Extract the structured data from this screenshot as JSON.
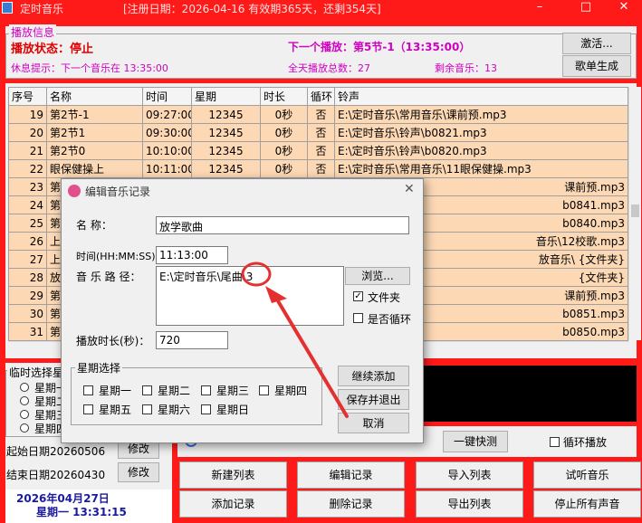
{
  "window": {
    "title": "定时音乐",
    "reg_info": "[注册日期：2026-04-16  有效期365天，还剩354天]"
  },
  "info": {
    "group_label": "播放信息",
    "status": "播放状态：停止",
    "next": "下一个播放：第5节-1（13:35:00）",
    "rest": "休息提示：下一个音乐在 13:35:00",
    "total": "全天播放总数：27",
    "remain": "剩余音乐：13",
    "activate_btn": "激活...",
    "gen_btn": "歌单生成"
  },
  "table": {
    "headers": [
      "序号",
      "名称",
      "时间",
      "星期",
      "时长",
      "循环",
      "铃声"
    ],
    "rows": [
      [
        "19",
        "第2节-1",
        "09:27:00",
        "12345",
        "0秒",
        "否",
        "E:\\定时音乐\\常用音乐\\课前预.mp3"
      ],
      [
        "20",
        "第2节1",
        "09:30:00",
        "12345",
        "0秒",
        "否",
        "E:\\定时音乐\\铃声\\b0821.mp3"
      ],
      [
        "21",
        "第2节0",
        "10:10:00",
        "12345",
        "0秒",
        "否",
        "E:\\定时音乐\\铃声\\b0820.mp3"
      ],
      [
        "22",
        "眼保健操上",
        "10:11:00",
        "12345",
        "0秒",
        "否",
        "E:\\定时音乐\\常用音乐\\11眼保健操.mp3"
      ],
      [
        "23",
        "第",
        "",
        "",
        "",
        "",
        "课前预.mp3"
      ],
      [
        "24",
        "第",
        "",
        "",
        "",
        "",
        "b0841.mp3"
      ],
      [
        "25",
        "第",
        "",
        "",
        "",
        "",
        "b0840.mp3"
      ],
      [
        "26",
        "上",
        "",
        "",
        "",
        "",
        "音乐\\12校歌.mp3"
      ],
      [
        "27",
        "上",
        "",
        "",
        "",
        "",
        "放音乐\\        {文件夹}"
      ],
      [
        "28",
        "放",
        "",
        "",
        "",
        "",
        "{文件夹}"
      ],
      [
        "29",
        "第",
        "",
        "",
        "",
        "",
        "课前预.mp3"
      ],
      [
        "30",
        "第",
        "",
        "",
        "",
        "",
        "b0851.mp3"
      ],
      [
        "31",
        "第",
        "",
        "",
        "",
        "",
        "b0850.mp3"
      ]
    ]
  },
  "temp": {
    "group_label": "临时选择星",
    "radios": [
      "星期一",
      "星期二",
      "星期三",
      "星期四"
    ],
    "start_date": "起始日期20260506",
    "end_date": "结束日期20260430",
    "modify": "修改",
    "clock_date": "2026年04月27日",
    "clock_time": "星期一   13:31:15"
  },
  "right_controls": {
    "quick": "一键快测",
    "loop": "循环播放"
  },
  "bottom_buttons": [
    "新建列表",
    "编辑记录",
    "导入列表",
    "试听音乐",
    "添加记录",
    "删除记录",
    "导出列表",
    "停止所有声音"
  ],
  "dialog": {
    "title": "编辑音乐记录",
    "name_label": "名      称：",
    "name_value": "放学歌曲",
    "time_label": "时间(HH:MM:SS)：",
    "time_value": "11:13:00",
    "path_label": "音 乐 路 径：",
    "path_value": "E:\\定时音乐\\尾曲\\3",
    "browse": "浏览...",
    "folder_cb": "文件夹",
    "loop_cb": "是否循环",
    "duration_label": "播放时长(秒)：",
    "duration_value": "720",
    "week_group": "星期选择",
    "weekdays": [
      "星期一",
      "星期二",
      "星期三",
      "星期四",
      "星期五",
      "星期六",
      "星期日"
    ],
    "continue_btn": "继续添加",
    "save_btn": "保存并退出",
    "cancel_btn": "取消"
  },
  "colors": {
    "frame": "#ff1a1a",
    "row": "#fcd8b4",
    "accent_red": "#e00000",
    "magenta": "#d000c0",
    "annotation": "#e53030"
  }
}
